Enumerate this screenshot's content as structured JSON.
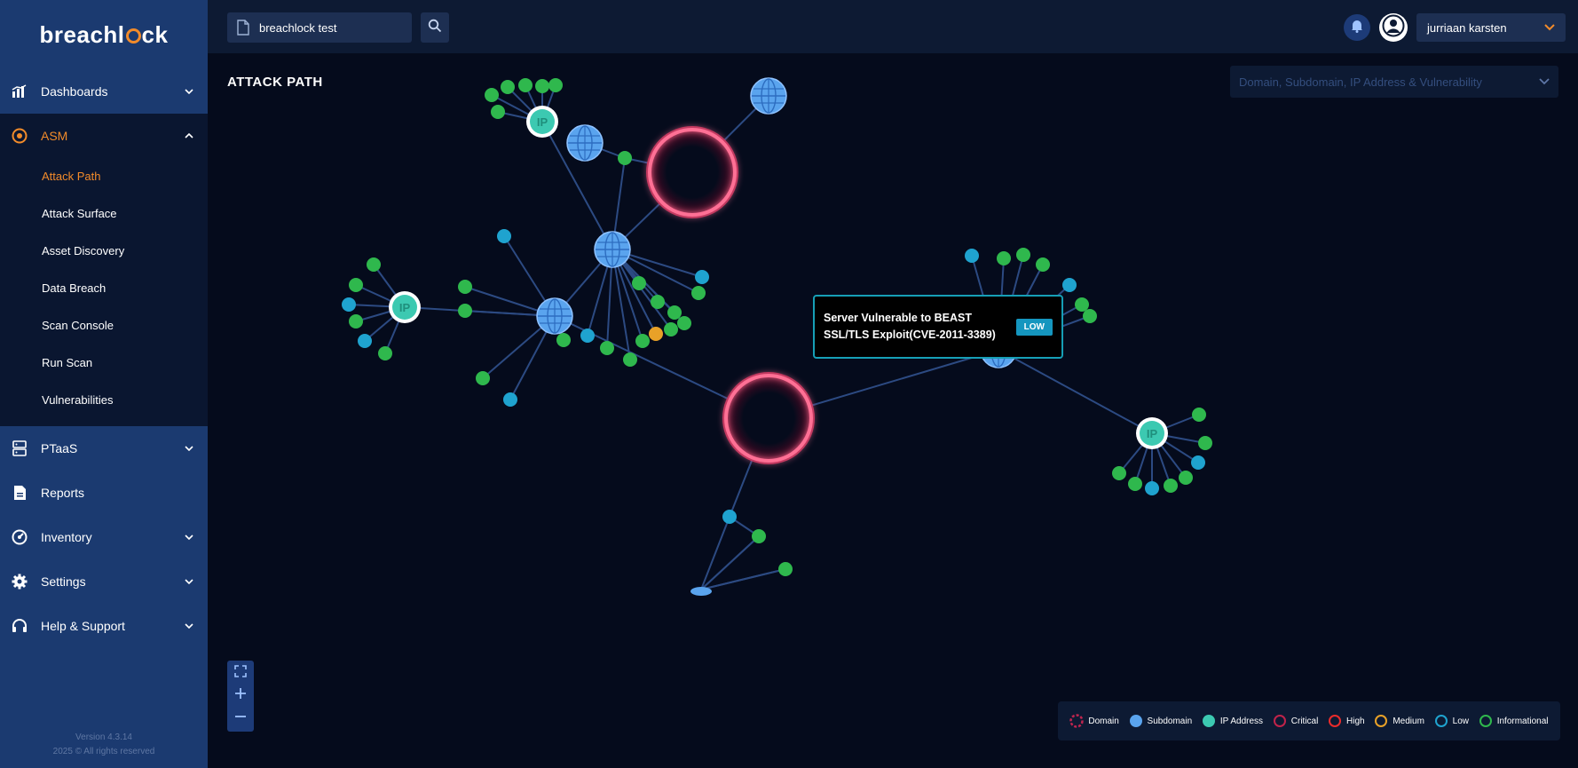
{
  "app": {
    "logo_text_a": "breachl",
    "logo_text_b": "ck"
  },
  "sidebar": {
    "dashboards": "Dashboards",
    "asm": "ASM",
    "asm_items": [
      {
        "label": "Attack Path",
        "active": true
      },
      {
        "label": "Attack Surface",
        "active": false
      },
      {
        "label": "Asset Discovery",
        "active": false
      },
      {
        "label": "Data Breach",
        "active": false
      },
      {
        "label": "Scan Console",
        "active": false
      },
      {
        "label": "Run Scan",
        "active": false
      },
      {
        "label": "Vulnerabilities",
        "active": false
      }
    ],
    "ptaas": "PTaaS",
    "reports": "Reports",
    "inventory": "Inventory",
    "settings": "Settings",
    "help": "Help & Support",
    "version": "Version 4.3.14",
    "copyright": "2025 © All rights reserved"
  },
  "topbar": {
    "search_value": "breachlock test",
    "user_name": "jurriaan karsten"
  },
  "main": {
    "title": "ATTACK PATH",
    "filter_label": "Domain, Subdomain, IP Address & Vulnerability"
  },
  "tooltip": {
    "text": "Server Vulnerable to BEAST SSL/TLS Exploit(CVE-2011-3389)",
    "severity": "LOW"
  },
  "legend": [
    {
      "label": "Domain",
      "kind": "domain",
      "color": "#c0254f"
    },
    {
      "label": "Subdomain",
      "kind": "subdomain",
      "color": "#5aa4ee"
    },
    {
      "label": "IP Address",
      "kind": "ip",
      "color": "#3cc9b1"
    },
    {
      "label": "Critical",
      "kind": "ring",
      "color": "#c0234a"
    },
    {
      "label": "High",
      "kind": "ring",
      "color": "#ea2b2b"
    },
    {
      "label": "Medium",
      "kind": "ring",
      "color": "#e8a128"
    },
    {
      "label": "Low",
      "kind": "ring",
      "color": "#1fa3cf"
    },
    {
      "label": "Informational",
      "kind": "ring",
      "color": "#2fb84d"
    }
  ],
  "colors": {
    "sidebar_bg": "#1b3a70",
    "accent_orange": "#f28b2a",
    "canvas_bg": "#050b1c",
    "edge": "#2c4a82",
    "domain_ring": "#ff6f95",
    "subdomain": "#5aa4ee",
    "ip": "#3cc9b1",
    "info": "#2fb84d",
    "low": "#1fa3cf",
    "medium": "#e8a128"
  }
}
